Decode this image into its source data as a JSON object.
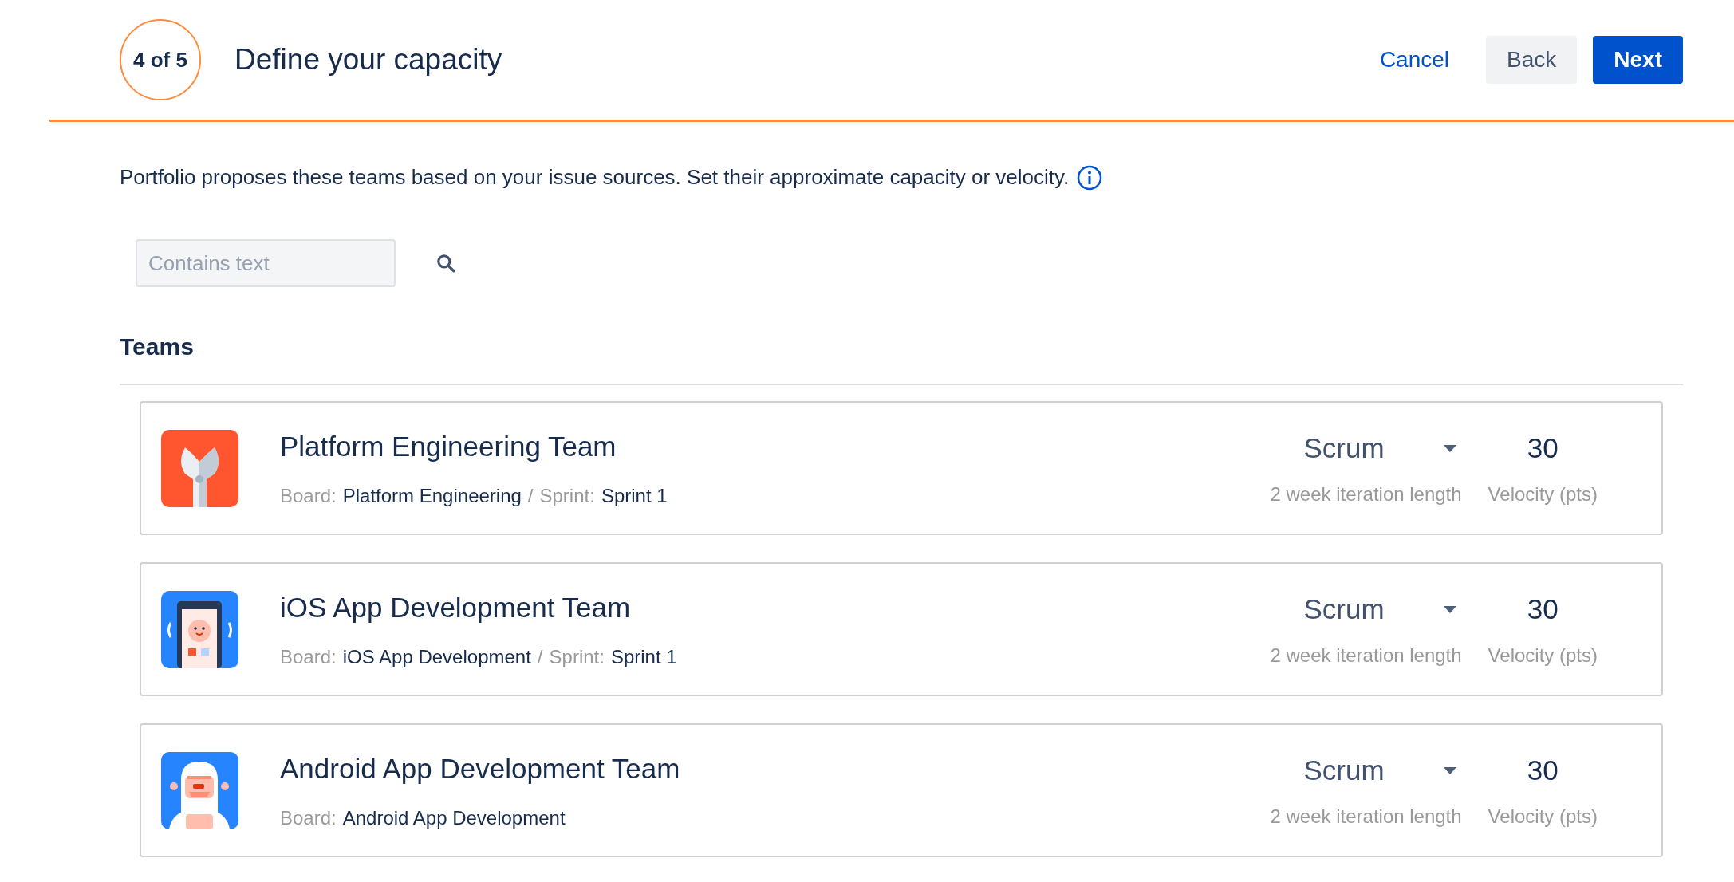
{
  "header": {
    "step": "4 of 5",
    "title": "Define your capacity",
    "buttons": [
      {
        "label": "Cancel",
        "kind": "link"
      },
      {
        "label": "Back",
        "kind": "subtle"
      },
      {
        "label": "Next",
        "kind": "primary"
      }
    ]
  },
  "description": "Portfolio proposes these teams based on your issue sources. Set their approximate capacity or velocity.",
  "search": {
    "placeholder": "Contains text"
  },
  "section_title": "Teams",
  "teams": [
    {
      "name": "Platform Engineering Team",
      "kind": "wrench",
      "details": [
        {
          "label": "Board:",
          "value": "Platform Engineering"
        },
        {
          "label": "Sprint:",
          "value": "Sprint 1"
        }
      ],
      "separator": "/",
      "method": "Scrum",
      "iteration": "2 week iteration length",
      "velocity": "30",
      "velocity_label": "Velocity (pts)"
    },
    {
      "name": "iOS App Development Team",
      "kind": "phone",
      "details": [
        {
          "label": "Board:",
          "value": "iOS App Development"
        },
        {
          "label": "Sprint:",
          "value": "Sprint 1"
        }
      ],
      "separator": "/",
      "method": "Scrum",
      "iteration": "2 week iteration length",
      "velocity": "30",
      "velocity_label": "Velocity (pts)"
    },
    {
      "name": "Android App Development Team",
      "kind": "yeti",
      "details": [
        {
          "label": "Board:",
          "value": "Android App Development"
        }
      ],
      "method": "Scrum",
      "iteration": "2 week iteration length",
      "velocity": "30",
      "velocity_label": "Velocity (pts)"
    }
  ]
}
